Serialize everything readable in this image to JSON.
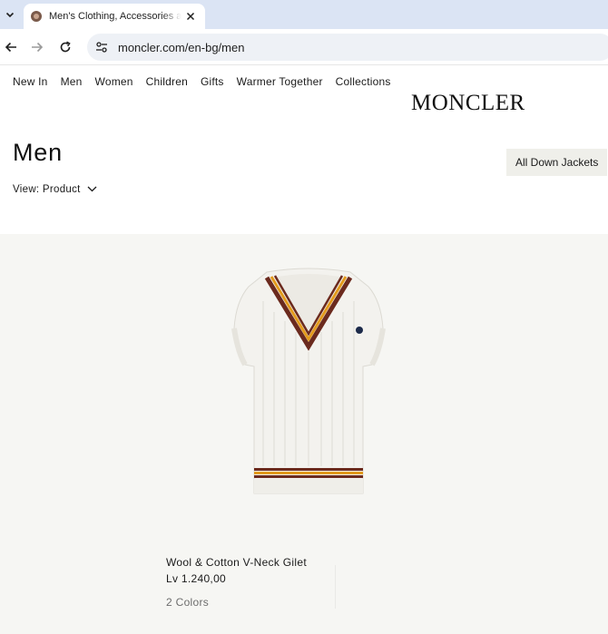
{
  "browser": {
    "tab_title": "Men's Clothing, Accessories and",
    "url": "moncler.com/en-bg/men"
  },
  "site": {
    "nav": [
      "New In",
      "Men",
      "Women",
      "Children",
      "Gifts",
      "Warmer Together",
      "Collections"
    ],
    "logo": "MONCLER"
  },
  "page": {
    "title": "Men",
    "view_label": "View: Product",
    "filter_chip": "All Down Jackets"
  },
  "product": {
    "name": "Wool & Cotton V-Neck Gilet",
    "price": "Lv 1.240,00",
    "colors": "2 Colors"
  },
  "colors": {
    "stripe_brown": "#6b2a1e",
    "stripe_orange": "#e39a1c",
    "knit_white": "#f3f2ee",
    "product_bg": "#f6f6f3"
  }
}
